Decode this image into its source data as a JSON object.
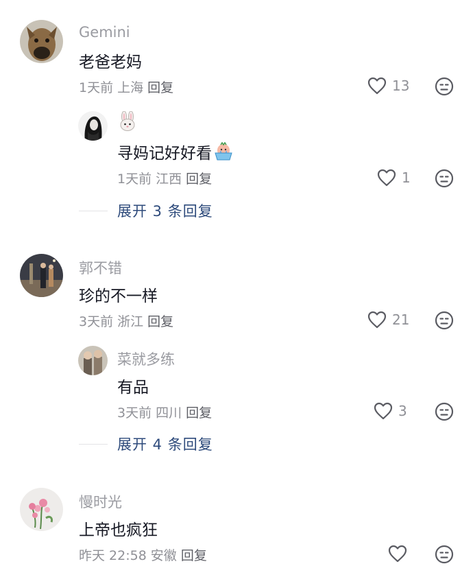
{
  "comments": [
    {
      "user": "Gemini",
      "text": "老爸老妈",
      "time": "1天前",
      "location": "上海",
      "reply": "回复",
      "likes": "13",
      "replies": [
        {
          "user": "",
          "user_emoji": "rabbit-face",
          "text": "寻妈记好好看",
          "text_emoji": "crying-face-in-bowl",
          "time": "1天前",
          "location": "江西",
          "reply": "回复",
          "likes": "1"
        }
      ],
      "expand": "展开 3 条回复"
    },
    {
      "user": "郭不错",
      "text": "珍的不一样",
      "time": "3天前",
      "location": "浙江",
      "reply": "回复",
      "likes": "21",
      "replies": [
        {
          "user": "菜就多练",
          "text": "有品",
          "time": "3天前",
          "location": "四川",
          "reply": "回复",
          "likes": "3"
        }
      ],
      "expand": "展开 4 条回复"
    },
    {
      "user": "慢时光",
      "text": "上帝也疯狂",
      "time": "昨天 22:58",
      "location": "安徽",
      "reply": "回复",
      "likes": ""
    }
  ],
  "icons": {
    "like": "heart-outline-icon",
    "dislike": "unhappy-face-icon"
  },
  "colors": {
    "link": "#2d4a7b",
    "meta": "#8f9096",
    "name": "#9a9ba1",
    "text": "#161823"
  }
}
